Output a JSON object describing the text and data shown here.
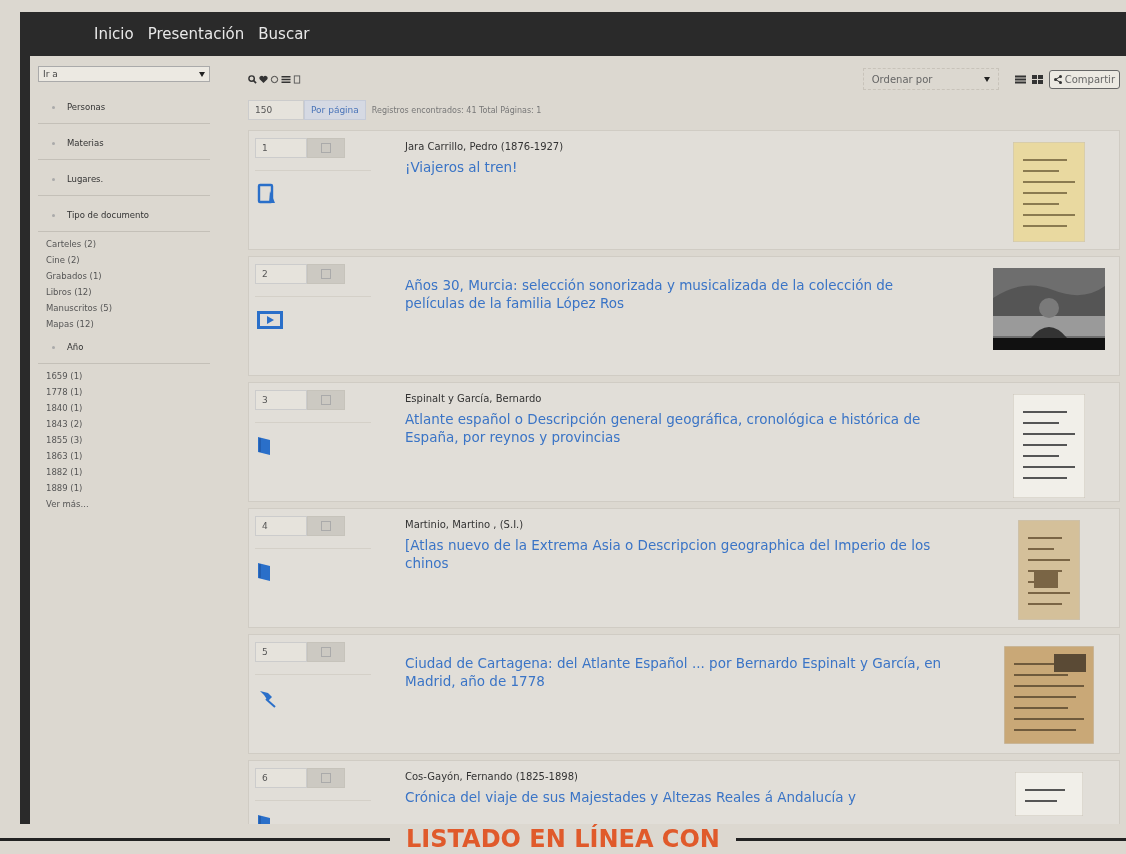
{
  "nav": {
    "items": [
      "Inicio",
      "Presentación",
      "Buscar"
    ]
  },
  "sidebar": {
    "goto": {
      "value": "Ir a"
    },
    "facets": [
      {
        "label": "Personas"
      },
      {
        "label": "Materias"
      },
      {
        "label": "Lugares."
      },
      {
        "label": "Tipo de documento",
        "items": [
          "Carteles (2)",
          "Cine (2)",
          "Grabados (1)",
          "Libros (12)",
          "Manuscritos (5)",
          "Mapas (12)"
        ]
      },
      {
        "label": "Año",
        "items": [
          "1659 (1)",
          "1778 (1)",
          "1840 (1)",
          "1843 (2)",
          "1855 (3)",
          "1863 (1)",
          "1882 (1)",
          "1889 (1)",
          "Ver más..."
        ]
      }
    ]
  },
  "toolbar": {
    "sort": {
      "placeholder": "Ordenar por"
    },
    "share": "Compartir",
    "per_page": {
      "value": "150"
    },
    "per_page_button": "Por página",
    "summary": "Registros encontrados: 41 Total Páginas: 1"
  },
  "results": [
    {
      "number": "1",
      "kind": "manuscript",
      "author": "Jara Carrillo, Pedro (1876-1927)",
      "title": "¡Viajeros al tren!"
    },
    {
      "number": "2",
      "kind": "video",
      "title": "Años 30, Murcia: selección sonorizada y musicalizada de la colección de películas de la familia López Ros"
    },
    {
      "number": "3",
      "kind": "book",
      "author": "Espinalt y García, Bernardo",
      "title": "Atlante español o Descripción general geográfica, cronológica e histórica de España, por reynos y provincias"
    },
    {
      "number": "4",
      "kind": "book",
      "author": "Martinio, Martino , (S.I.)",
      "title": "[Atlas nuevo de la Extrema Asia o Descripcion geographica del Imperio de los chinos"
    },
    {
      "number": "5",
      "kind": "map",
      "title": "Ciudad de Cartagena: del Atlante Español ... por Bernardo Espinalt y García, en Madrid, año de 1778"
    },
    {
      "number": "6",
      "kind": "book",
      "author": "Cos-Gayón, Fernando (1825-1898)",
      "title": "Crónica del viaje de sus Majestades y Altezas Reales á Andalucía y"
    }
  ],
  "caption": "LISTADO EN LÍNEA CON"
}
